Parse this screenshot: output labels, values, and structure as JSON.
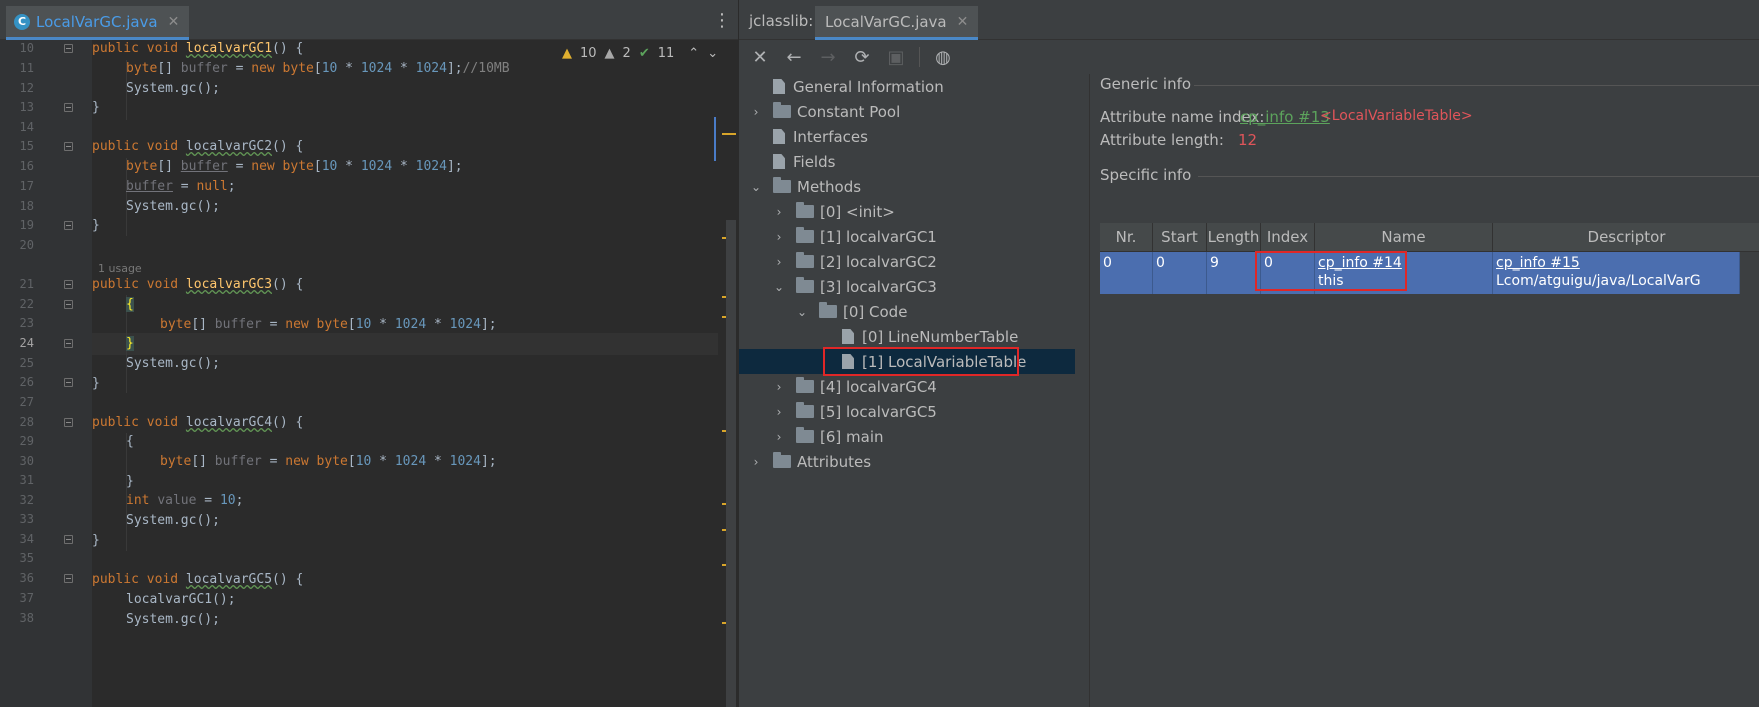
{
  "editor": {
    "tab_label": "LocalVarGC.java",
    "tab_icon": "C",
    "close_glyph": "✕",
    "menu_glyph": "⋮",
    "inspections": {
      "warnings_yellow": "10",
      "warnings_grey": "2",
      "ok": "11"
    },
    "usage_hint": "1 usage",
    "line_numbers": [
      "10",
      "11",
      "12",
      "13",
      "14",
      "15",
      "16",
      "17",
      "18",
      "19",
      "20",
      "21",
      "22",
      "23",
      "24",
      "25",
      "26",
      "27",
      "28",
      "29",
      "30",
      "31",
      "32",
      "33",
      "34",
      "35",
      "36",
      "37",
      "38"
    ],
    "current_line": "24"
  },
  "code": {
    "l10": {
      "a": "public void ",
      "b": "localvarGC1",
      "c": "() {"
    },
    "l11": {
      "a": "byte",
      "b": "[] ",
      "c": "buffer",
      "d": " = ",
      "e": "new byte",
      "f": "[",
      "g": "10",
      "h": " * ",
      "i": "1024",
      "j": " * ",
      "k": "1024",
      "l": "];",
      "m": "//10MB"
    },
    "l12": "System.gc();",
    "l13": "}",
    "l15": {
      "a": "public void ",
      "b": "localvarGC2",
      "c": "() {"
    },
    "l16": {
      "a": "byte",
      "b": "[] ",
      "c": "buffer",
      "d": " = ",
      "e": "new byte",
      "f": "[",
      "g": "10",
      "h": " * ",
      "i": "1024",
      "j": " * ",
      "k": "1024",
      "l": "];"
    },
    "l17": {
      "a": "buffer",
      "b": " = ",
      "c": "null",
      "d": ";"
    },
    "l18": "System.gc();",
    "l19": "}",
    "l21": {
      "a": "public void ",
      "b": "localvarGC3",
      "c": "() {"
    },
    "l22": "{",
    "l23": {
      "a": "byte",
      "b": "[] ",
      "c": "buffer",
      "d": " = ",
      "e": "new byte",
      "f": "[",
      "g": "10",
      "h": " * ",
      "i": "1024",
      "j": " * ",
      "k": "1024",
      "l": "];"
    },
    "l24": "}",
    "l25": "System.gc();",
    "l26": "}",
    "l28": {
      "a": "public void ",
      "b": "localvarGC4",
      "c": "() {"
    },
    "l29": "{",
    "l30": {
      "a": "byte",
      "b": "[] ",
      "c": "buffer",
      "d": " = ",
      "e": "new byte",
      "f": "[",
      "g": "10",
      "h": " * ",
      "i": "1024",
      "j": " * ",
      "k": "1024",
      "l": "];"
    },
    "l31": "}",
    "l32": {
      "a": "int ",
      "b": "value",
      "c": " = ",
      "d": "10",
      "e": ";"
    },
    "l33": "System.gc();",
    "l34": "}",
    "l36": {
      "a": "public void ",
      "b": "localvarGC5",
      "c": "() {"
    },
    "l37": "localvarGC1();",
    "l38": "System.gc();"
  },
  "jclasslib": {
    "prefix": "jclasslib:",
    "tab_label": "LocalVarGC.java",
    "close_glyph": "✕",
    "toolbar": [
      "close-icon",
      "back-icon",
      "forward-icon",
      "reload-icon",
      "save-icon",
      "browser-icon"
    ],
    "tree": [
      {
        "label": "General Information"
      },
      {
        "label": "Constant Pool"
      },
      {
        "label": "Interfaces"
      },
      {
        "label": "Fields"
      },
      {
        "label": "Methods"
      },
      {
        "label": "[0] <init>"
      },
      {
        "label": "[1] localvarGC1"
      },
      {
        "label": "[2] localvarGC2"
      },
      {
        "label": "[3] localvarGC3"
      },
      {
        "label": "[0] Code"
      },
      {
        "label": "[0] LineNumberTable"
      },
      {
        "label": "[1] LocalVariableTable"
      },
      {
        "label": "[4] localvarGC4"
      },
      {
        "label": "[5] localvarGC5"
      },
      {
        "label": "[6] main"
      },
      {
        "label": "Attributes"
      }
    ],
    "detail": {
      "generic_header": "Generic info",
      "attr_name_label": "Attribute name index:",
      "attr_name_link": "cp_info #13",
      "attr_name_value": "<LocalVariableTable>",
      "attr_len_label": "Attribute length:",
      "attr_len_value": "12",
      "specific_header": "Specific info",
      "columns": [
        "Nr.",
        "Start PC",
        "Length",
        "Index",
        "Name",
        "Descriptor"
      ],
      "row": {
        "nr": "0",
        "start_pc": "0",
        "length": "9",
        "index": "0",
        "name_link": "cp_info #14",
        "name_value": "this",
        "desc_link": "cp_info #15",
        "desc_value": "Lcom/atguigu/java/LocalVarG"
      }
    }
  },
  "colors": {
    "accent_tab": "#4a88c7",
    "selection_row": "#4b6eaf",
    "highlight_box": "#e02727",
    "link_green": "#5ca35c",
    "value_red": "#e0555a"
  }
}
